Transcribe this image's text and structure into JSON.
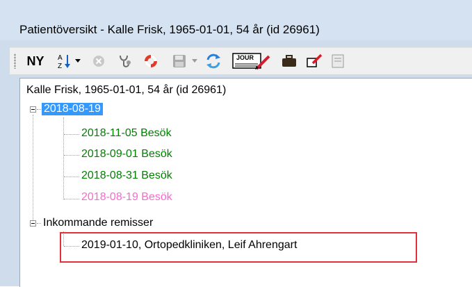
{
  "window": {
    "title": "Patientöversikt - Kalle Frisk, 1965-01-01, 54 år (id 26961)"
  },
  "toolbar": {
    "ny_label": "NY",
    "journal_label": "JOUR",
    "buttons": [
      {
        "icon": "sort-az-icon"
      },
      {
        "icon": "dropdown-arrow-icon"
      },
      {
        "icon": "cancel-circle-icon"
      },
      {
        "icon": "stethoscope-icon"
      },
      {
        "icon": "lifebuoy-icon"
      },
      {
        "icon": "save-disk-icon"
      },
      {
        "icon": "dropdown-arrow-icon"
      },
      {
        "icon": "refresh-icon"
      },
      {
        "icon": "journal-pen-icon"
      },
      {
        "icon": "briefcase-icon"
      },
      {
        "icon": "edit-note-icon"
      },
      {
        "icon": "partial-icon"
      }
    ]
  },
  "tree": {
    "root": "Kalle Frisk, 1965-01-01, 54 år (id 26961)",
    "groups": [
      {
        "label": "2018-08-19",
        "selected": true,
        "children": [
          {
            "label": "2018-11-05 Besök",
            "color": "#008000"
          },
          {
            "label": "2018-09-01 Besök",
            "color": "#008000"
          },
          {
            "label": "2018-08-31 Besök",
            "color": "#008000"
          },
          {
            "label": "2018-08-19 Besök",
            "color": "#ff66cc"
          }
        ]
      },
      {
        "label": "Inkommande remisser",
        "selected": false,
        "children": [
          {
            "label": "2019-01-10, Ortopedkliniken, Leif Ahrengart",
            "color": "#000000"
          }
        ]
      }
    ]
  },
  "colors": {
    "selection": "#3399ff",
    "highlight_border": "#e0303a",
    "visit_green": "#008000",
    "visit_pink": "#ff66cc"
  }
}
